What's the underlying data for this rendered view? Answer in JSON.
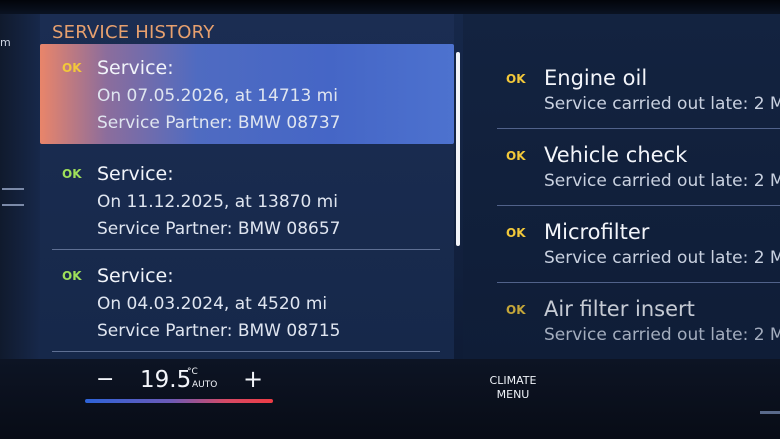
{
  "sidebar": {
    "label": "m"
  },
  "history": {
    "title": "SERVICE HISTORY",
    "entries": [
      {
        "status": "OK",
        "status_color": "#f2c83a",
        "title": "Service:",
        "date_line": "On 07.05.2026, at 14713 mi",
        "partner_line": "Service Partner: BMW 08737",
        "selected": true
      },
      {
        "status": "OK",
        "status_color": "#9ee05a",
        "title": "Service:",
        "date_line": "On 11.12.2025, at 13870 mi",
        "partner_line": "Service Partner: BMW 08657",
        "selected": false
      },
      {
        "status": "OK",
        "status_color": "#9ee05a",
        "title": "Service:",
        "date_line": "On 04.03.2024, at 4520 mi",
        "partner_line": "Service Partner: BMW 08715",
        "selected": false
      }
    ]
  },
  "items": [
    {
      "status": "OK",
      "status_color": "#f2c83a",
      "name": "Engine oil",
      "detail": "Service carried out late: 2 M"
    },
    {
      "status": "OK",
      "status_color": "#f2c83a",
      "name": "Vehicle check",
      "detail": "Service carried out late: 2 M"
    },
    {
      "status": "OK",
      "status_color": "#f2c83a",
      "name": "Microfilter",
      "detail": "Service carried out late: 2 M"
    },
    {
      "status": "OK",
      "status_color": "#f2c83a",
      "name": "Air filter insert",
      "detail": "Service carried out late: 2 M"
    }
  ],
  "climate": {
    "minus": "−",
    "temperature": "19.5",
    "unit": "°C",
    "mode": "AUTO",
    "plus": "+",
    "menu_line1": "CLIMATE",
    "menu_line2": "MENU"
  },
  "colors": {
    "accent_title": "#e7a06e",
    "ok_yellow": "#f2c83a",
    "ok_green": "#9ee05a"
  }
}
